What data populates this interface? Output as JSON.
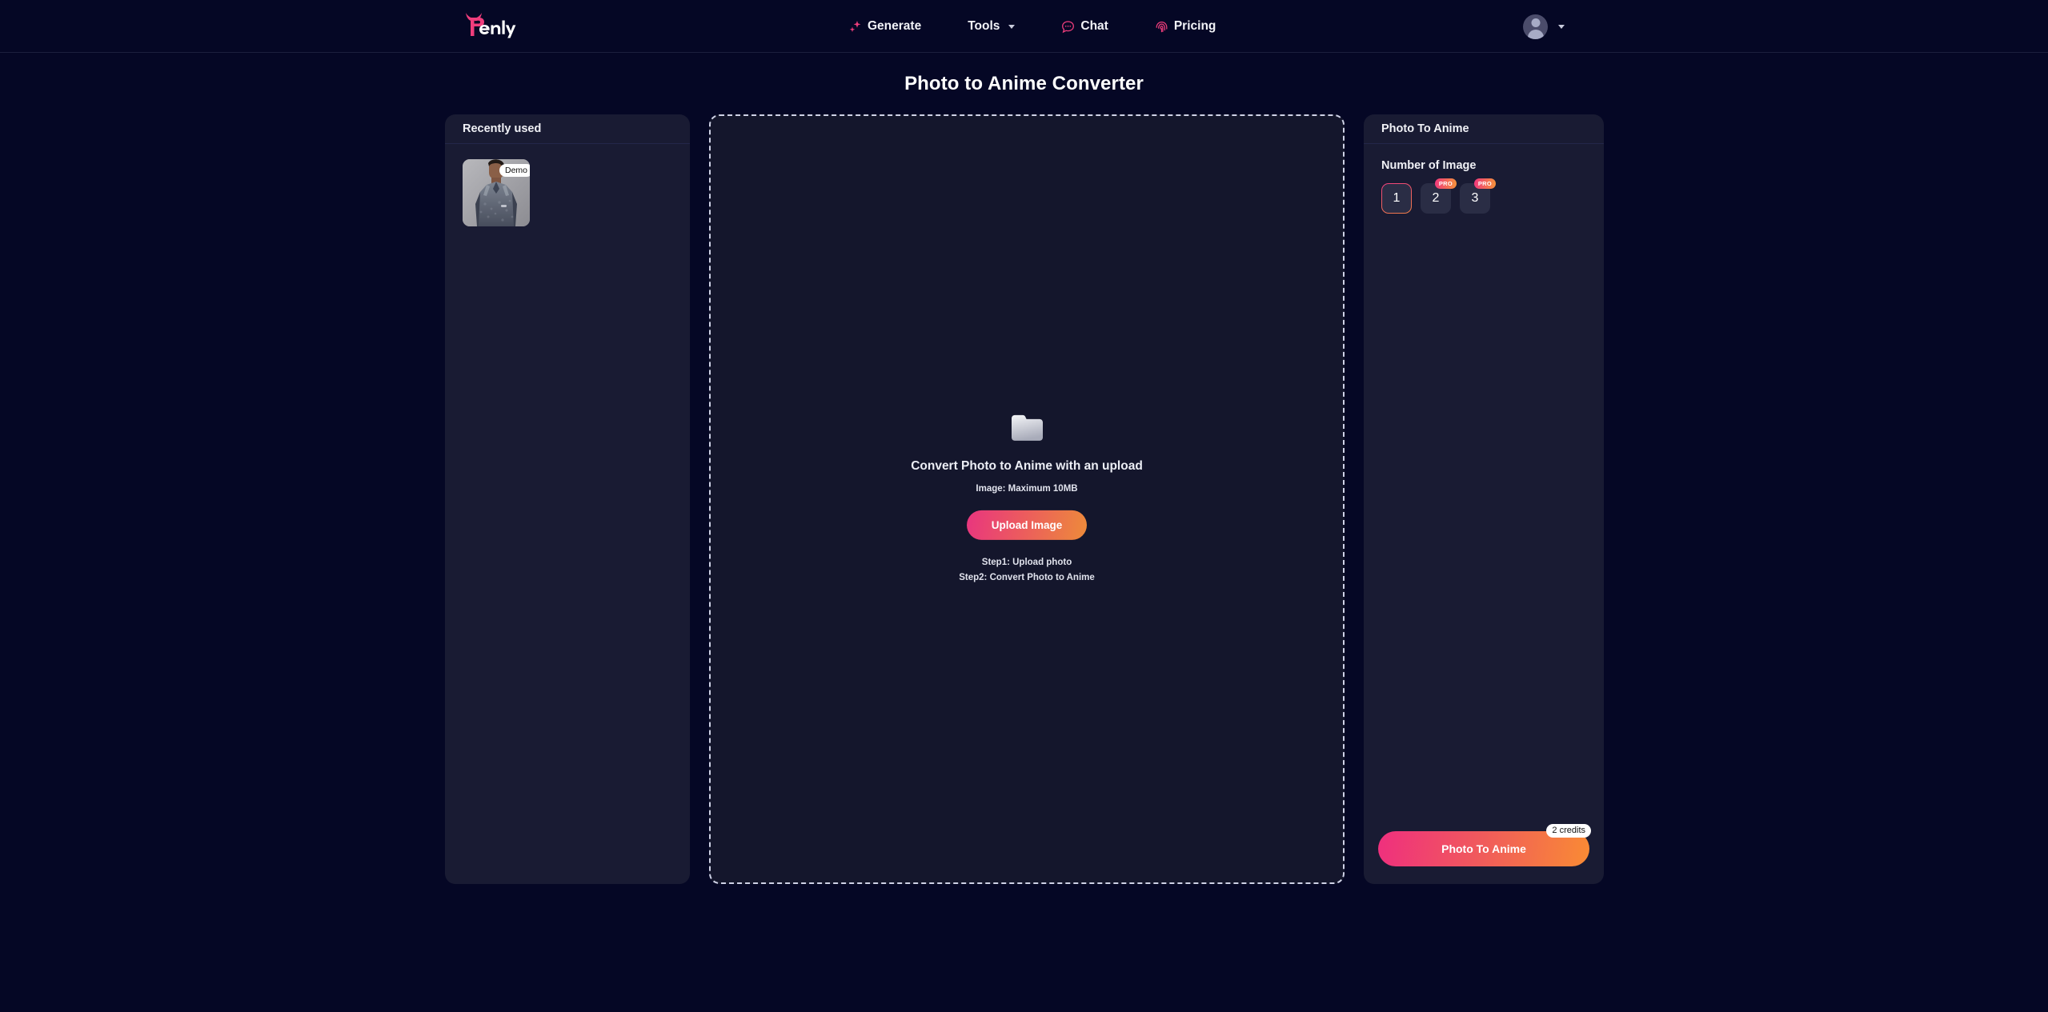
{
  "header": {
    "logo_text": "Penly",
    "nav": [
      {
        "label": "Generate",
        "icon": "sparkle-icon"
      },
      {
        "label": "Tools",
        "icon": "chevron-down-icon"
      },
      {
        "label": "Chat",
        "icon": "chat-bubble-icon"
      },
      {
        "label": "Pricing",
        "icon": "fingerprint-icon"
      }
    ],
    "account": {
      "icon": "avatar-icon",
      "caret": "chevron-down-icon"
    }
  },
  "page": {
    "title": "Photo to Anime Converter"
  },
  "recently_used": {
    "title": "Recently used",
    "items": [
      {
        "badge": "Demo",
        "alt": "man in grey athletic shirt"
      }
    ]
  },
  "upload": {
    "folder_icon": "folder-icon",
    "title": "Convert Photo to Anime with an upload",
    "subtitle": "Image: Maximum  10MB",
    "button_label": "Upload Image",
    "step1": "Step1: Upload photo",
    "step2": "Step2: Convert Photo to Anime"
  },
  "options": {
    "title": "Photo To Anime",
    "number_label": "Number of Image",
    "numbers": [
      {
        "value": "1",
        "pro": false,
        "selected": true
      },
      {
        "value": "2",
        "pro": true,
        "selected": false
      },
      {
        "value": "3",
        "pro": true,
        "selected": false
      }
    ],
    "pro_badge": "PRO",
    "cta_label": "Photo To Anime",
    "credits_badge": "2 credits"
  },
  "colors": {
    "page_bg": "#050725",
    "panel_bg": "#191b33",
    "accent_pink": "#ef2f7e",
    "accent_orange": "#f98b34",
    "text_primary": "#ffffff"
  }
}
